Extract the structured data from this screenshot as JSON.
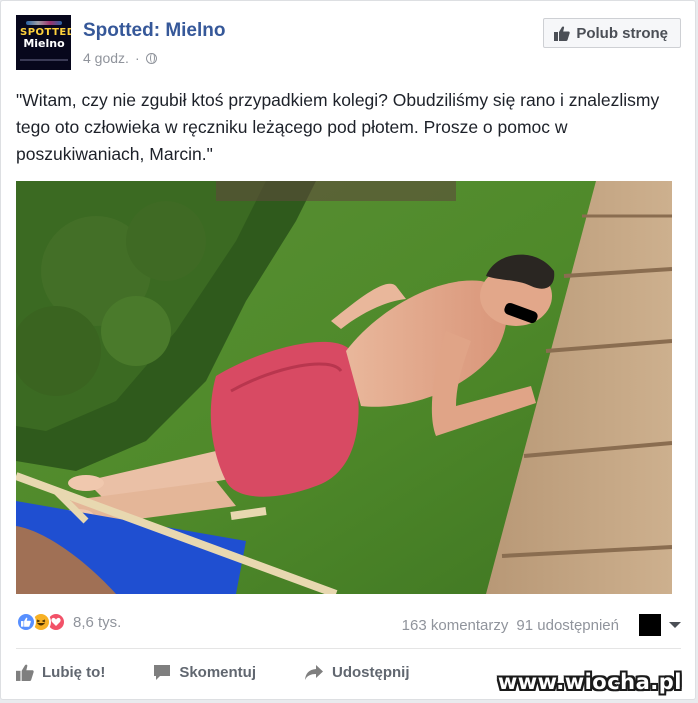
{
  "post": {
    "page_name": "Spotted: Mielno",
    "time_ago": "4 godz.",
    "separator": "·",
    "like_page_label": "Polub stronę",
    "avatar_text_1": "SPOTTED!",
    "avatar_text_2": "Mielno",
    "text": "\"Witam, czy nie zgubił ktoś przypadkiem kolegi? Obudziliśmy się rano i znalezlismy tego oto człowieka w ręczniku leżącego pod płotem. Prosze o pomoc w poszukiwaniach, Marcin.\""
  },
  "stats": {
    "reactions": [
      "like",
      "haha",
      "love"
    ],
    "reaction_count": "8,6 tys.",
    "comments": "163 komentarzy",
    "shares": "91 udostępnień"
  },
  "actions": {
    "like": "Lubię to!",
    "comment": "Skomentuj",
    "share": "Udostępnij"
  },
  "colors": {
    "brand_link": "#365899",
    "like_blue": "#5890ff",
    "love_red": "#f25268",
    "haha_yellow": "#f7b125"
  },
  "watermark": "www.wiocha.pl"
}
